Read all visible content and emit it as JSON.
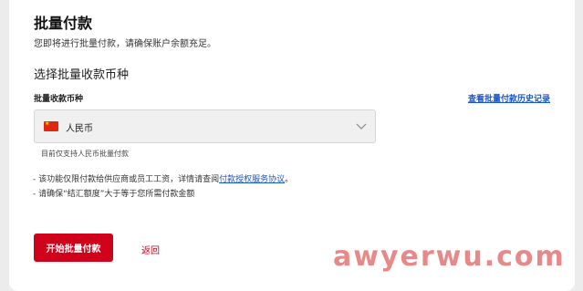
{
  "header": {
    "title": "批量付款",
    "subtitle": "您即将进行批量付款，请确保账户余额充足。"
  },
  "section": {
    "title": "选择批量收款币种"
  },
  "currency_field": {
    "label": "批量收款币种",
    "history_link": "查看批量付款历史记录",
    "selected_value": "人民币",
    "flag_icon": "china-flag-icon",
    "helper": "目前仅支持人民币批量付款"
  },
  "notes": {
    "line1_prefix": "- 该功能仅限付款给供应商或员工工资，详情请查阅",
    "line1_link": "付款授权服务协议",
    "line1_suffix": "。",
    "line2": "- 请确保“结汇额度”大于等于您所需付款金额"
  },
  "actions": {
    "primary": "开始批量付款",
    "back": "返回"
  },
  "watermark": "awyerwu.com",
  "colors": {
    "accent": "#d0021b",
    "link": "#1a56c9"
  }
}
